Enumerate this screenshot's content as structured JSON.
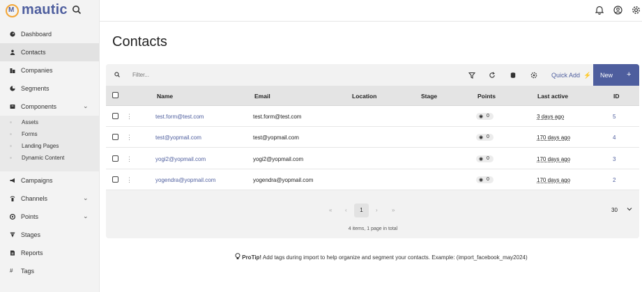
{
  "app": {
    "logo_text": "mautic",
    "logo_glyph": "M"
  },
  "sidebar": {
    "items": [
      {
        "label": "Dashboard",
        "icon": "dashboard-icon"
      },
      {
        "label": "Contacts",
        "icon": "user-icon",
        "active": true
      },
      {
        "label": "Companies",
        "icon": "building-icon"
      },
      {
        "label": "Segments",
        "icon": "pie-chart-icon"
      },
      {
        "label": "Components",
        "icon": "box-icon",
        "chevron": "⌄"
      },
      {
        "label": "Campaigns",
        "icon": "megaphone-icon"
      },
      {
        "label": "Channels",
        "icon": "broadcast-icon",
        "chevron": "⌄"
      },
      {
        "label": "Points",
        "icon": "points-icon",
        "chevron": "⌄"
      },
      {
        "label": "Stages",
        "icon": "stages-icon"
      },
      {
        "label": "Reports",
        "icon": "report-icon"
      },
      {
        "label": "Tags",
        "icon": "hash-icon",
        "glyph": "#"
      }
    ],
    "sub_items": [
      "Assets",
      "Forms",
      "Landing Pages",
      "Dynamic Content"
    ]
  },
  "main": {
    "title": "Contacts",
    "toolbar": {
      "filter_placeholder": "Filter...",
      "quick_add_label": "Quick Add",
      "quick_add_icon": "⚡",
      "new_label": "New",
      "new_icon": "+"
    },
    "table": {
      "headers": [
        "Name",
        "Email",
        "Location",
        "Stage",
        "Points",
        "Last active",
        "ID"
      ],
      "rows": [
        {
          "name": "test.form@test.com",
          "email": "test.form@test.com",
          "location": "",
          "stage": "",
          "points": "0",
          "last_active": "3 days ago",
          "id": "5"
        },
        {
          "name": "test@yopmail.com",
          "email": "test@yopmail.com",
          "location": "",
          "stage": "",
          "points": "0",
          "last_active": "170 days ago",
          "id": "4"
        },
        {
          "name": "yogi2@yopmail.com",
          "email": "yogi2@yopmail.com",
          "location": "",
          "stage": "",
          "points": "0",
          "last_active": "170 days ago",
          "id": "3"
        },
        {
          "name": "yogendra@yopmail.com",
          "email": "yogendra@yopmail.com",
          "location": "",
          "stage": "",
          "points": "0",
          "last_active": "170 days ago",
          "id": "2"
        }
      ]
    },
    "pagination": {
      "first": "«",
      "prev": "‹",
      "current": "1",
      "next": "›",
      "last": "»",
      "per_page": "30",
      "summary": "4 items, 1 page in total"
    },
    "protip": {
      "label": "ProTip!",
      "text": " Add tags during import to help organize and segment your contacts. Example: (import_facebook_may2024)"
    }
  },
  "colors": {
    "brand": "#4e5e9e",
    "logo_accent": "#f3a534"
  }
}
